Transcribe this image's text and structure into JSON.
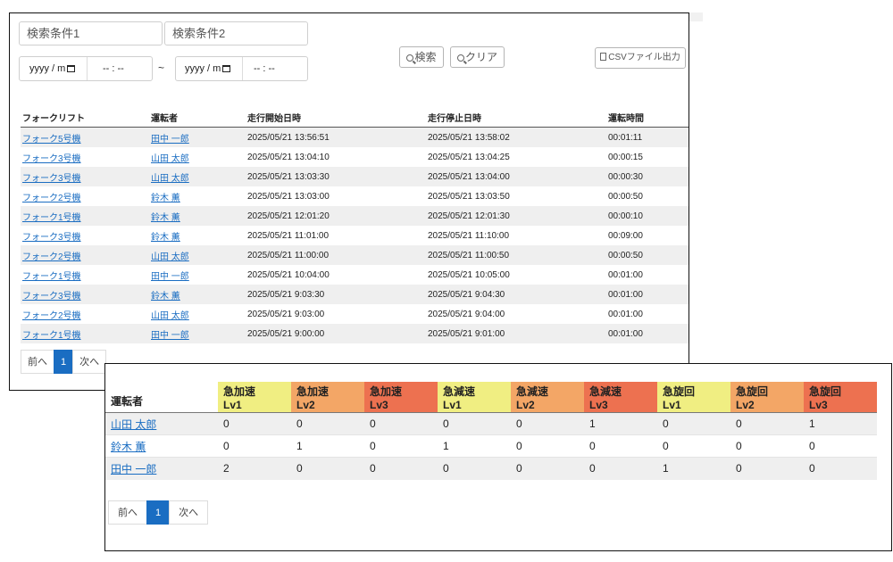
{
  "search": {
    "cond1_placeholder": "検索条件1",
    "cond2_placeholder": "検索条件2",
    "date_placeholder": "yyyy / m",
    "time_placeholder": "-- : --",
    "tilde": "~",
    "search_button": "検索",
    "clear_button": "クリア",
    "csv_button": "CSVファイル出力"
  },
  "log_table": {
    "headers": [
      "フォークリフト",
      "運転者",
      "走行開始日時",
      "走行停止日時",
      "運転時間"
    ],
    "rows": [
      [
        "フォーク5号機",
        "田中 一郎",
        "2025/05/21 13:56:51",
        "2025/05/21 13:58:02",
        "00:01:11"
      ],
      [
        "フォーク3号機",
        "山田 太郎",
        "2025/05/21 13:04:10",
        "2025/05/21 13:04:25",
        "00:00:15"
      ],
      [
        "フォーク3号機",
        "山田 太郎",
        "2025/05/21 13:03:30",
        "2025/05/21 13:04:00",
        "00:00:30"
      ],
      [
        "フォーク2号機",
        "鈴木 薫",
        "2025/05/21 13:03:00",
        "2025/05/21 13:03:50",
        "00:00:50"
      ],
      [
        "フォーク1号機",
        "鈴木 薫",
        "2025/05/21 12:01:20",
        "2025/05/21 12:01:30",
        "00:00:10"
      ],
      [
        "フォーク3号機",
        "鈴木 薫",
        "2025/05/21 11:01:00",
        "2025/05/21 11:10:00",
        "00:09:00"
      ],
      [
        "フォーク2号機",
        "山田 太郎",
        "2025/05/21 11:00:00",
        "2025/05/21 11:00:50",
        "00:00:50"
      ],
      [
        "フォーク1号機",
        "田中 一郎",
        "2025/05/21 10:04:00",
        "2025/05/21 10:05:00",
        "00:01:00"
      ],
      [
        "フォーク3号機",
        "鈴木 薫",
        "2025/05/21 9:03:30",
        "2025/05/21 9:04:30",
        "00:01:00"
      ],
      [
        "フォーク2号機",
        "山田 太郎",
        "2025/05/21 9:03:00",
        "2025/05/21 9:04:00",
        "00:01:00"
      ],
      [
        "フォーク1号機",
        "田中 一郎",
        "2025/05/21 9:00:00",
        "2025/05/21 9:01:00",
        "00:01:00"
      ]
    ]
  },
  "pager1": {
    "prev": "前へ",
    "page": "1",
    "next": "次へ"
  },
  "event_table": {
    "driver_header": "運転者",
    "headers": [
      {
        "name": "急加速",
        "level": "Lv1",
        "color": "#f0ee82"
      },
      {
        "name": "急加速",
        "level": "Lv2",
        "color": "#f3a666"
      },
      {
        "name": "急加速",
        "level": "Lv3",
        "color": "#ed7150"
      },
      {
        "name": "急減速",
        "level": "Lv1",
        "color": "#f0ee82"
      },
      {
        "name": "急減速",
        "level": "Lv2",
        "color": "#f3a666"
      },
      {
        "name": "急減速",
        "level": "Lv3",
        "color": "#ed7150"
      },
      {
        "name": "急旋回",
        "level": "Lv1",
        "color": "#f0ee82"
      },
      {
        "name": "急旋回",
        "level": "Lv2",
        "color": "#f3a666"
      },
      {
        "name": "急旋回",
        "level": "Lv3",
        "color": "#ed7150"
      }
    ],
    "rows": [
      {
        "driver": "山田 太郎",
        "values": [
          "0",
          "0",
          "0",
          "0",
          "0",
          "1",
          "0",
          "0",
          "1"
        ]
      },
      {
        "driver": "鈴木 薫",
        "values": [
          "0",
          "1",
          "0",
          "1",
          "0",
          "0",
          "0",
          "0",
          "0"
        ]
      },
      {
        "driver": "田中 一郎",
        "values": [
          "2",
          "0",
          "0",
          "0",
          "0",
          "0",
          "1",
          "0",
          "0"
        ]
      }
    ]
  },
  "pager2": {
    "prev": "前へ",
    "page": "1",
    "next": "次へ"
  }
}
